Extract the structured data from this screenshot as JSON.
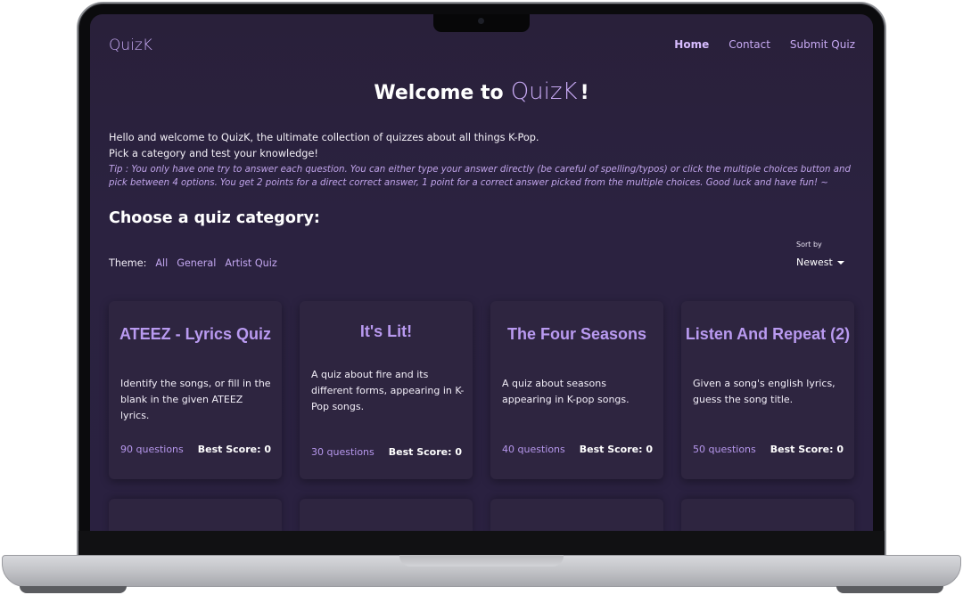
{
  "nav": {
    "logo": "QuizK",
    "links": [
      "Home",
      "Contact",
      "Submit Quiz"
    ]
  },
  "welcome": {
    "prefix": "Welcome to",
    "brand": "QuizK",
    "suffix": "!"
  },
  "intro": {
    "line1": "Hello and welcome to QuizK, the ultimate collection of quizzes about all things K-Pop.",
    "line2": "Pick a category and test your knowledge!",
    "tip": "Tip : You only have one try to answer each question. You can either type your answer directly (be careful of spelling/typos) or click the multiple choices button and pick between 4 options. You get 2 points for a direct correct answer, 1 point for a correct answer picked from the multiple choices. Good luck and have fun! ~"
  },
  "categories": {
    "heading": "Choose a quiz category:",
    "theme_label": "Theme:",
    "themes": [
      "All",
      "General",
      "Artist Quiz"
    ],
    "sort_label": "Sort by",
    "sort_value": "Newest"
  },
  "cards": [
    {
      "title": "ATEEZ - Lyrics Quiz",
      "description": "Identify the songs, or fill in the blank in the given ATEEZ lyrics.",
      "questions": "90 questions",
      "best": "Best Score: 0"
    },
    {
      "title": "It's Lit!",
      "description": "A quiz about fire and its different forms, appearing in K-Pop songs.",
      "questions": "30 questions",
      "best": "Best Score: 0"
    },
    {
      "title": "The Four Seasons",
      "description": "A quiz about seasons appearing in K-pop songs.",
      "questions": "40 questions",
      "best": "Best Score: 0"
    },
    {
      "title": "Listen And Repeat (2)",
      "description": "Given a song's english lyrics, guess the song title.",
      "questions": "50 questions",
      "best": "Best Score: 0"
    }
  ],
  "colors": {
    "background": "#2a2140",
    "accent": "#c7a9f3",
    "card": "#2e2540"
  }
}
